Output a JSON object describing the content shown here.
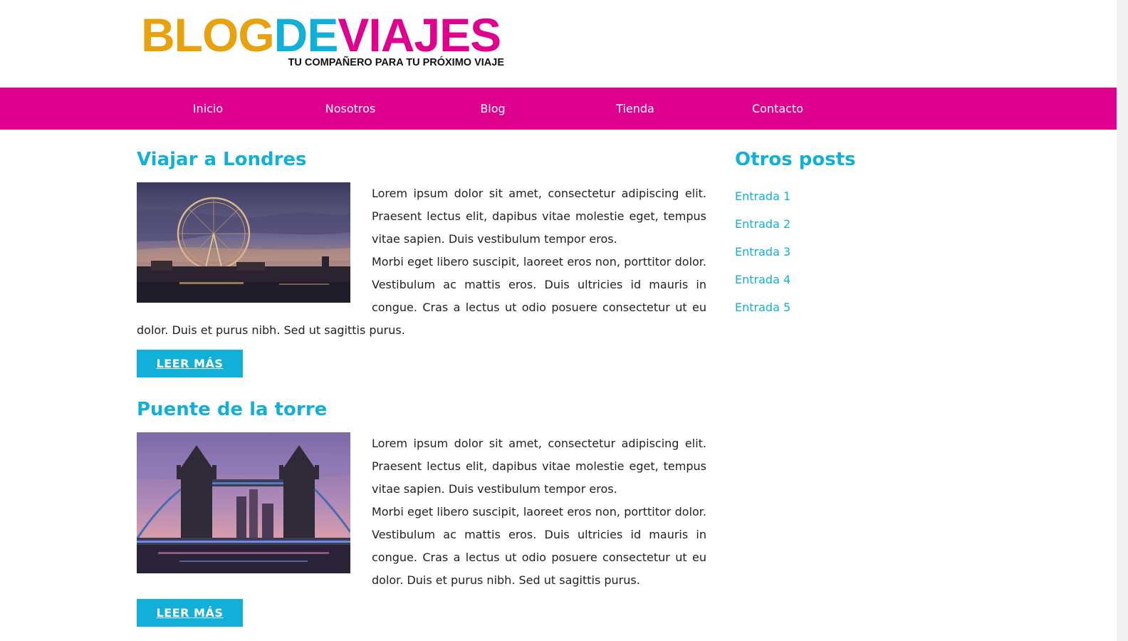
{
  "logo": {
    "parts": [
      {
        "text": "BLOG",
        "color": "#e9a20f"
      },
      {
        "text": "DE",
        "color": "#12afd8"
      },
      {
        "text": "VIAJES",
        "color": "#e0008e"
      }
    ],
    "tagline": "TU COMPAÑERO PARA TU PRÓXIMO VIAJE"
  },
  "nav": {
    "items": [
      {
        "label": "Inicio"
      },
      {
        "label": "Nosotros"
      },
      {
        "label": "Blog"
      },
      {
        "label": "Tienda"
      },
      {
        "label": "Contacto"
      }
    ]
  },
  "posts": [
    {
      "title": "Viajar a Londres",
      "image": "london-eye-photo",
      "paragraphs": [
        "Lorem ipsum dolor sit amet, consectetur adipiscing elit. Praesent lectus elit, dapibus vitae molestie eget, tempus vitae sapien. Duis vestibulum tempor eros.",
        "Morbi eget libero suscipit, laoreet eros non, porttitor dolor. Vestibulum ac mattis eros. Duis ultricies id mauris in congue. Cras a lectus ut odio posuere consectetur ut eu dolor. Duis et purus nibh. Sed ut sagittis purus."
      ],
      "button": "LEER MÁS"
    },
    {
      "title": "Puente de la torre",
      "image": "tower-bridge-photo",
      "paragraphs": [
        "Lorem ipsum dolor sit amet, consectetur adipiscing elit. Praesent lectus elit, dapibus vitae molestie eget, tempus vitae sapien. Duis vestibulum tempor eros.",
        "Morbi eget libero suscipit, laoreet eros non, porttitor dolor. Vestibulum ac mattis eros. Duis ultricies id mauris in congue. Cras a lectus ut odio posuere consectetur ut eu dolor. Duis et purus nibh. Sed ut sagittis purus."
      ],
      "button": "LEER MÁS"
    }
  ],
  "sidebar": {
    "title": "Otros posts",
    "items": [
      {
        "label": "Entrada 1"
      },
      {
        "label": "Entrada 2"
      },
      {
        "label": "Entrada 3"
      },
      {
        "label": "Entrada 4"
      },
      {
        "label": "Entrada 5"
      }
    ]
  },
  "colors": {
    "accent_pink": "#e0008e",
    "accent_blue": "#12afd8",
    "accent_orange": "#e9a20f"
  }
}
